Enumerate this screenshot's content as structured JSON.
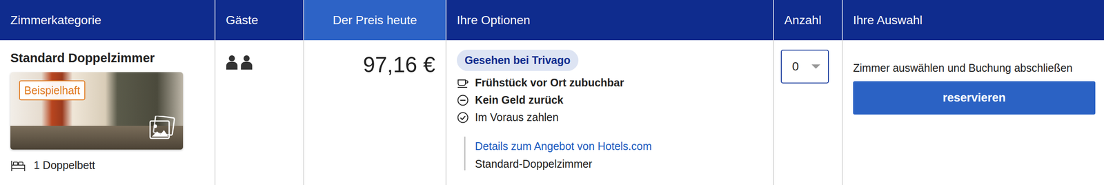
{
  "table": {
    "columns": [
      {
        "label": "Zimmerkategorie",
        "selected": false
      },
      {
        "label": "Gäste",
        "selected": false
      },
      {
        "label": "Der Preis heute",
        "selected": true
      },
      {
        "label": "Ihre Optionen",
        "selected": false
      },
      {
        "label": "Anzahl",
        "selected": false
      },
      {
        "label": "Ihre Auswahl",
        "selected": false
      }
    ],
    "rows": [
      {
        "room": "Standard Doppelzimmer",
        "image_badge": "Beispielhaft",
        "bed": "1 Doppelbett",
        "guests": 2,
        "price": "97,16 €",
        "badge": "Gesehen bei Trivago",
        "options": [
          {
            "text": "Frühstück vor Ort zubuchbar",
            "bold": true,
            "kind": "breakfast"
          },
          {
            "text": "Kein Geld zurück",
            "bold": true,
            "kind": "nonrefundable"
          },
          {
            "text": "Im Voraus zahlen",
            "bold": false,
            "kind": "prepay"
          }
        ],
        "offer_link": "Details zum Angebot von Hotels.com",
        "offer_name": "Standard-Doppelzimmer",
        "quantity": "0",
        "hint": "Zimmer auswählen und Buchung abschließen",
        "button": "reservieren"
      }
    ]
  }
}
